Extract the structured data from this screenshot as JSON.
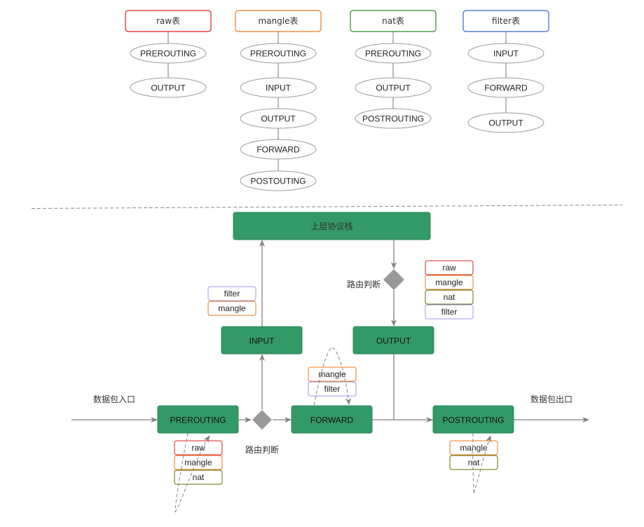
{
  "colors": {
    "raw": "#dd1f1f",
    "mangle": "#ee7a1a",
    "nat": "#6a6a00",
    "nat_header": "#2a8a2a",
    "filter": "#9999ee",
    "filter_header": "#3366cc",
    "chain_box": "#339966",
    "arrow": "#808080",
    "decision": "#999999"
  },
  "tables": [
    {
      "name": "raw",
      "header": "raw表",
      "chains": [
        "PREROUTING",
        "OUTPUT"
      ]
    },
    {
      "name": "mangle",
      "header": "mangle表",
      "chains": [
        "PREROUTING",
        "INPUT",
        "OUTPUT",
        "FORWARD",
        "POSTOUTING"
      ]
    },
    {
      "name": "nat",
      "header": "nat表",
      "chains": [
        "PREROUTING",
        "OUTPUT",
        "POSTROUTING"
      ]
    },
    {
      "name": "filter",
      "header": "filter表",
      "chains": [
        "INPUT",
        "FORWARD",
        "OUTPUT"
      ]
    }
  ],
  "flow": {
    "upper_stack": "上层协议栈",
    "entry_label": "数据包入口",
    "exit_label": "数据包出口",
    "routing_decision_label": "路由判断",
    "chains": {
      "prerouting": {
        "label": "PREROUTING",
        "tables": [
          "raw",
          "mangle",
          "nat"
        ]
      },
      "input": {
        "label": "INPUT",
        "tables": [
          "filter",
          "mangle"
        ]
      },
      "forward": {
        "label": "FORWARD",
        "tables": [
          "mangle",
          "filter"
        ]
      },
      "output": {
        "label": "OUTPUT",
        "tables": [
          "raw",
          "mangle",
          "nat",
          "filter"
        ]
      },
      "postrouting": {
        "label": "POSTROUTING",
        "tables": [
          "mangle",
          "nat"
        ]
      }
    }
  }
}
